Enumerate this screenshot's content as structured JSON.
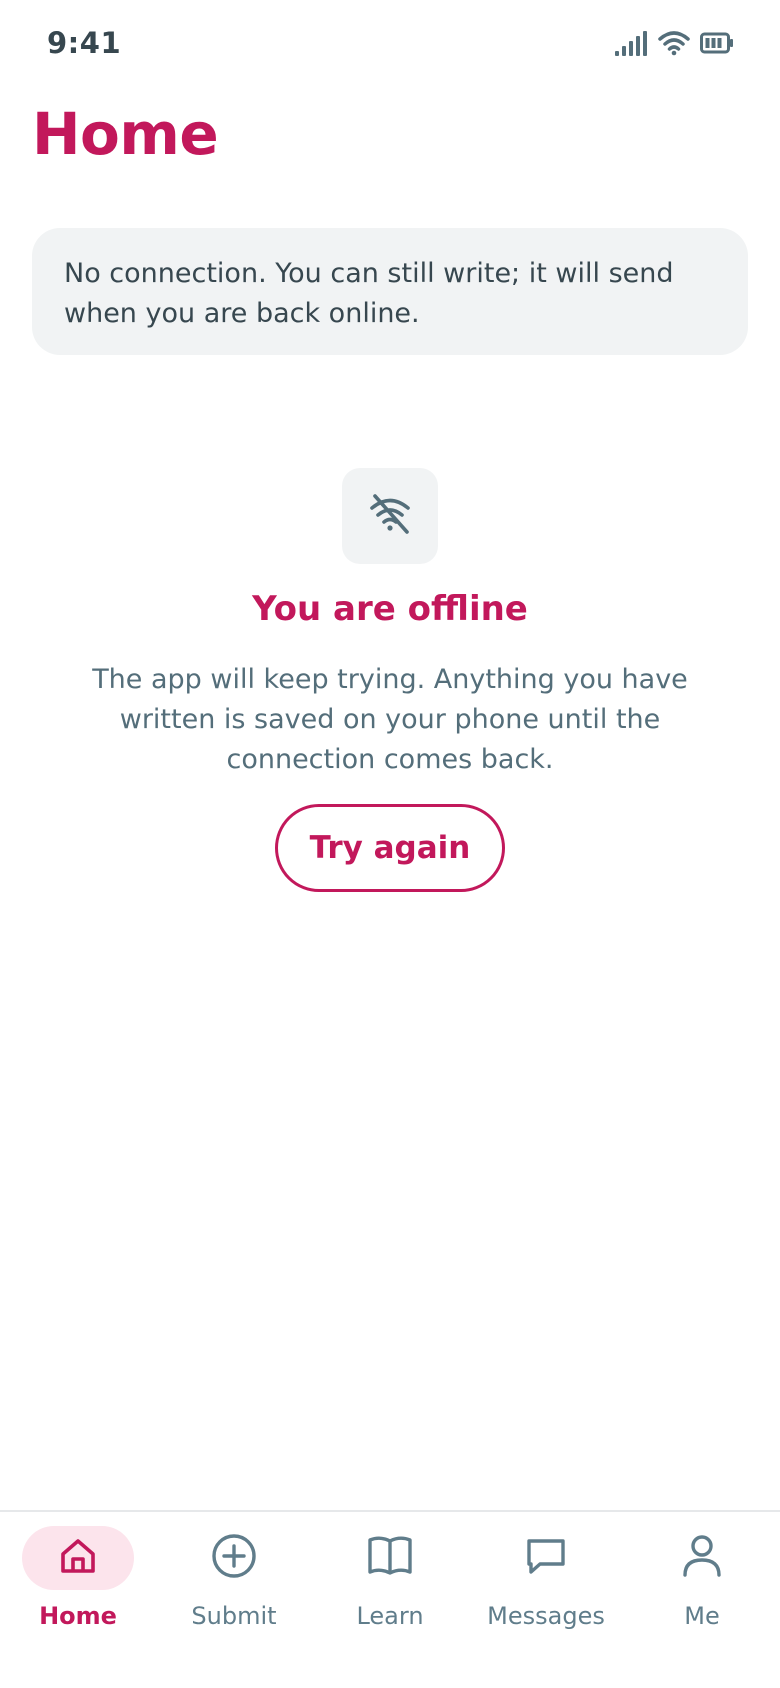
{
  "status_bar": {
    "time": "9:41",
    "icons": [
      "signal-icon",
      "wifi-icon",
      "battery-icon"
    ]
  },
  "page": {
    "title": "Home"
  },
  "banner": {
    "text": "No connection. You can still write; it will send when you are back online."
  },
  "offline": {
    "icon": "wifi-off-icon",
    "title": "You are offline",
    "body": "The app will keep trying. Anything you have written is saved on your phone until the connection comes back.",
    "button_label": "Try again"
  },
  "nav": {
    "items": [
      {
        "label": "Home",
        "icon": "home-icon",
        "active": true
      },
      {
        "label": "Submit",
        "icon": "add-circle-icon",
        "active": false
      },
      {
        "label": "Learn",
        "icon": "book-icon",
        "active": false
      },
      {
        "label": "Messages",
        "icon": "chat-icon",
        "active": false
      },
      {
        "label": "Me",
        "icon": "person-icon",
        "active": false
      }
    ]
  },
  "colors": {
    "accent": "#c2185b",
    "accent_soft": "#fce4ec",
    "text": "#37474f",
    "muted": "#607d8b",
    "surface": "#f1f3f4"
  }
}
